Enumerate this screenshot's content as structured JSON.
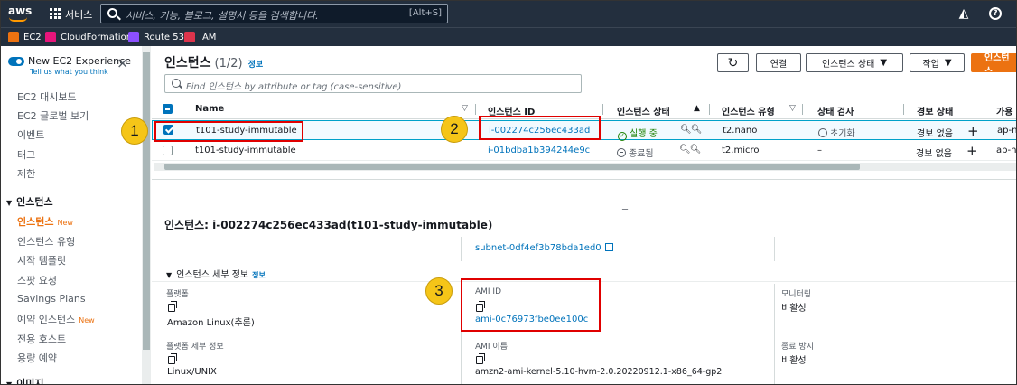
{
  "topnav": {
    "logo": "aws",
    "services_label": "서비스",
    "search_placeholder": "서비스, 기능, 블로그, 설명서 등을 검색합니다.",
    "search_shortcut": "[Alt+S]"
  },
  "favorites": [
    {
      "label": "EC2",
      "color": "#ec7211",
      "icon": "ec2-icon"
    },
    {
      "label": "CloudFormation",
      "color": "#e7157b",
      "icon": "cloudformation-icon"
    },
    {
      "label": "Route 53",
      "color": "#8c4fff",
      "icon": "route53-icon"
    },
    {
      "label": "IAM",
      "color": "#dd344c",
      "icon": "iam-icon"
    }
  ],
  "sidebar": {
    "new_experience": "New EC2 Experience",
    "tell_us": "Tell us what you think",
    "items_top": [
      "EC2 대시보드",
      "EC2 글로벌 보기",
      "이벤트",
      "태그",
      "제한"
    ],
    "section_instances": "인스턴스",
    "instance_items": [
      {
        "label": "인스턴스",
        "badge": "New",
        "active": true
      },
      {
        "label": "인스턴스 유형"
      },
      {
        "label": "시작 템플릿"
      },
      {
        "label": "스팟 요청"
      },
      {
        "label": "Savings Plans"
      },
      {
        "label": "예약 인스턴스",
        "badge": "New"
      },
      {
        "label": "전용 호스트"
      },
      {
        "label": "용량 예약"
      }
    ],
    "section_images": "이미지"
  },
  "list": {
    "title": "인스턴스",
    "count": "(1/2)",
    "info": "정보",
    "buttons": {
      "refresh": "↻",
      "connect": "연결",
      "state": "인스턴스 상태",
      "actions": "작업",
      "launch": "인스턴스"
    },
    "find_placeholder": "Find 인스턴스 by attribute or tag (case-sensitive)",
    "columns": [
      "Name",
      "인스턴스 ID",
      "인스턴스 상태",
      "인스턴스 유형",
      "상태 검사",
      "경보 상태",
      "가용"
    ],
    "rows": [
      {
        "name": "t101-study-immutable",
        "id": "i-002274c256ec433ad",
        "state": "실행 중",
        "type": "t2.nano",
        "check": "초기화",
        "alarm": "경보 없음",
        "az": "ap-n",
        "selected": true
      },
      {
        "name": "t101-study-immutable",
        "id": "i-01bdba1b394244e9c",
        "state": "종료됨",
        "type": "t2.micro",
        "check": "–",
        "alarm": "경보 없음",
        "az": "ap-n",
        "selected": false
      }
    ]
  },
  "detail": {
    "title": "인스턴스: i-002274c256ec433ad(t101-study-immutable)",
    "subnet": "subnet-0df4ef3b78bda1ed0",
    "section": "인스턴스 세부 정보",
    "section_info": "정보",
    "fields": {
      "platform_label": "플랫폼",
      "platform_value": "Amazon Linux(추론)",
      "ami_id_label": "AMI ID",
      "ami_id_value": "ami-0c76973fbe0ee100c",
      "monitoring_label": "모니터링",
      "monitoring_value": "비활성",
      "platform_detail_label": "플랫폼 세부 정보",
      "platform_detail_value": "Linux/UNIX",
      "ami_name_label": "AMI 이름",
      "ami_name_value": "amzn2-ami-kernel-5.10-hvm-2.0.20220912.1-x86_64-gp2",
      "stop_protect_label": "종료 방지",
      "stop_protect_value": "비활성"
    }
  },
  "annotations": [
    "1",
    "2",
    "3"
  ]
}
